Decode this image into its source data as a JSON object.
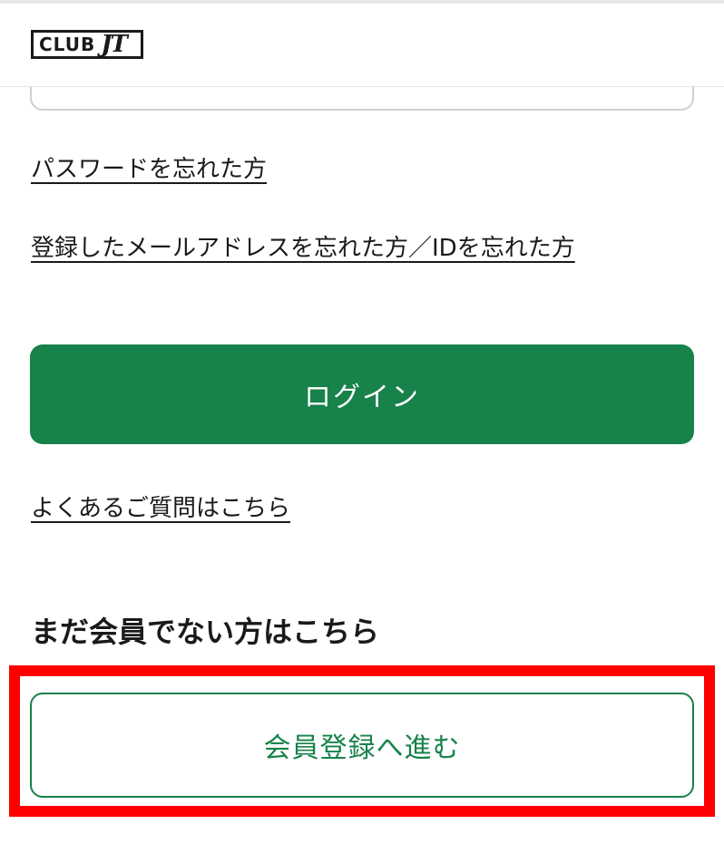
{
  "header": {
    "logo_text": "CLUB",
    "logo_mark": "JT"
  },
  "login": {
    "forgot_password_link": "パスワードを忘れた方",
    "forgot_email_id_link": "登録したメールアドレスを忘れた方／IDを忘れた方",
    "login_button_label": "ログイン",
    "faq_link": "よくあるご質問はこちら"
  },
  "register": {
    "section_title": "まだ会員でない方はこちら",
    "register_button_label": "会員登録へ進む"
  },
  "colors": {
    "brand_green": "#17824a",
    "highlight_red": "#ff0000"
  }
}
